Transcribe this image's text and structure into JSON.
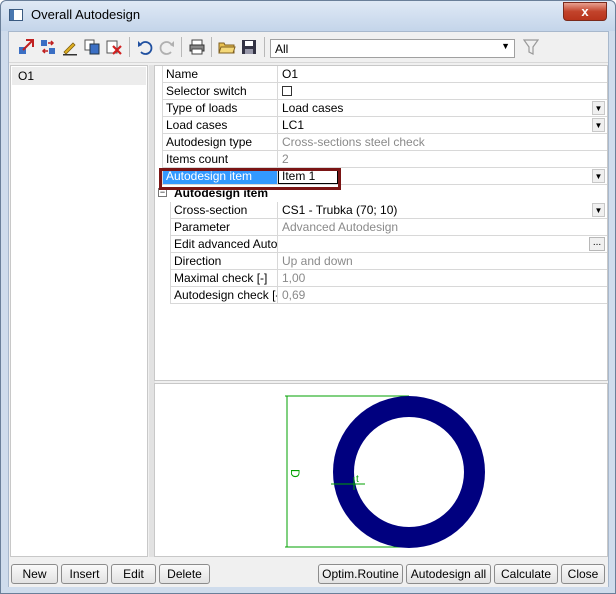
{
  "window": {
    "title": "Overall Autodesign",
    "close_glyph": "x"
  },
  "toolbar": {
    "icons": [
      "select-icon",
      "move-icon",
      "edit-icon",
      "copy-icon",
      "delete-icon",
      "undo-icon",
      "redo-icon",
      "print-icon",
      "open-icon",
      "save-icon"
    ],
    "filter_value": "All",
    "filter_icon": "funnel-icon"
  },
  "tree": {
    "items": [
      {
        "label": "O1"
      }
    ]
  },
  "properties": {
    "name": {
      "label": "Name",
      "value": "O1"
    },
    "selector_switch": {
      "label": "Selector switch",
      "checked": false
    },
    "type_of_loads": {
      "label": "Type of loads",
      "value": "Load cases"
    },
    "load_cases": {
      "label": "Load cases",
      "value": "LC1"
    },
    "autodesign_type": {
      "label": "Autodesign type",
      "value": "Cross-sections steel check"
    },
    "items_count": {
      "label": "Items count",
      "value": "2"
    },
    "autodesign_item": {
      "label": "Autodesign item",
      "value": "Item 1"
    }
  },
  "group": {
    "title": "Autodesign item",
    "expander": "−",
    "rows": {
      "cross_section": {
        "label": "Cross-section",
        "value": "CS1 - Trubka (70; 10)"
      },
      "parameter": {
        "label": "Parameter",
        "value": "Advanced Autodesign"
      },
      "edit_advanced": {
        "label": "Edit advanced Auto...",
        "value": "",
        "button": "..."
      },
      "direction": {
        "label": "Direction",
        "value": "Up and down"
      },
      "maximal_check": {
        "label": "Maximal check [-]",
        "value": "1,00"
      },
      "autodesign_check": {
        "label": "Autodesign check [-]",
        "value": "0,69"
      }
    }
  },
  "preview": {
    "dim_d_label": "D",
    "dim_t_label": "t",
    "section_color": "#00007f",
    "dimension_color": "#00a000"
  },
  "buttons": {
    "new": "New",
    "insert": "Insert",
    "edit": "Edit",
    "delete": "Delete",
    "optim_routine": "Optim.Routine",
    "autodesign_all": "Autodesign all",
    "calculate": "Calculate",
    "close": "Close"
  },
  "colors": {
    "selection": "#3399ff",
    "highlight_frame": "#7a1515"
  }
}
